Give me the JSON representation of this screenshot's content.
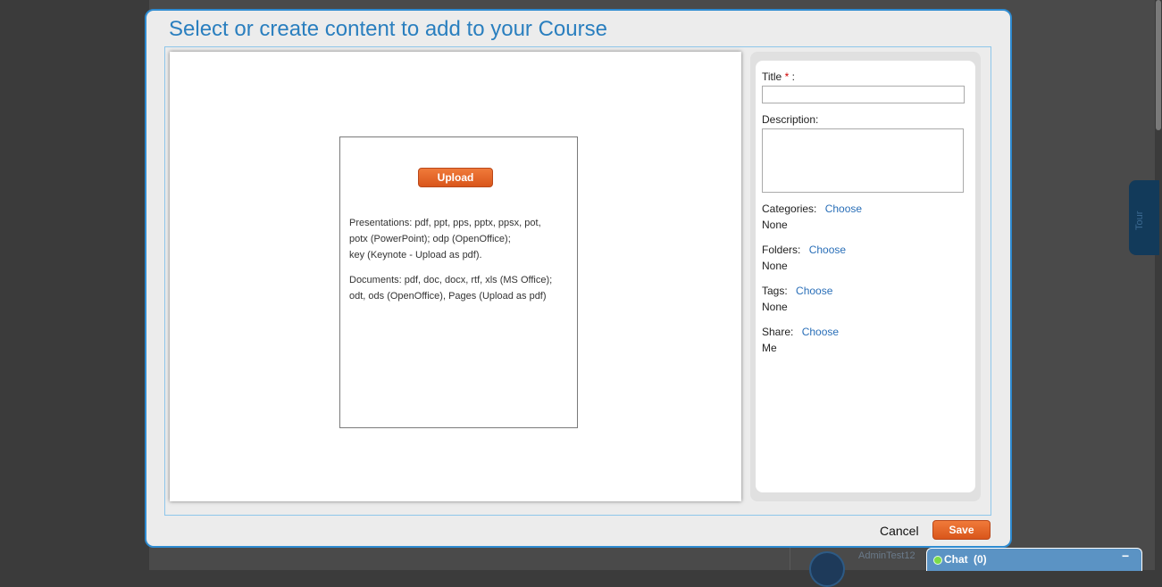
{
  "modal": {
    "title": "Select or create content to add to your Course",
    "upload_label": "Upload",
    "formats": {
      "presentations_line1": "Presentations: pdf, ppt, pps, pptx, ppsx, pot,",
      "presentations_line2": "potx (PowerPoint); odp (OpenOffice);",
      "presentations_line3": "key (Keynote - Upload as pdf).",
      "documents_line1": "Documents: pdf, doc, docx, rtf, xls (MS Office);",
      "documents_line2": "odt, ods (OpenOffice), Pages (Upload as pdf)"
    },
    "form": {
      "title_label": "Title",
      "required_mark": "*",
      "title_suffix": " :",
      "title_value": "",
      "description_label": "Description:",
      "description_value": "",
      "categories_label": "Categories:",
      "categories_choose": "Choose",
      "categories_value": "None",
      "folders_label": "Folders:",
      "folders_choose": "Choose",
      "folders_value": "None",
      "tags_label": "Tags:",
      "tags_choose": "Choose",
      "tags_value": "None",
      "share_label": "Share:",
      "share_choose": "Choose",
      "share_value": "Me"
    },
    "cancel_label": "Cancel",
    "save_label": "Save"
  },
  "background": {
    "tour_label": "Tour",
    "username": "AdminTest12"
  },
  "chat": {
    "label": "Chat",
    "count": "(0)",
    "minimize": "−",
    "status_color": "#7cdc4a"
  },
  "colors": {
    "accent": "#2a7fbf",
    "button_orange": "#e2621f",
    "link": "#2a6fb8",
    "modal_border": "#2e8bd1"
  }
}
